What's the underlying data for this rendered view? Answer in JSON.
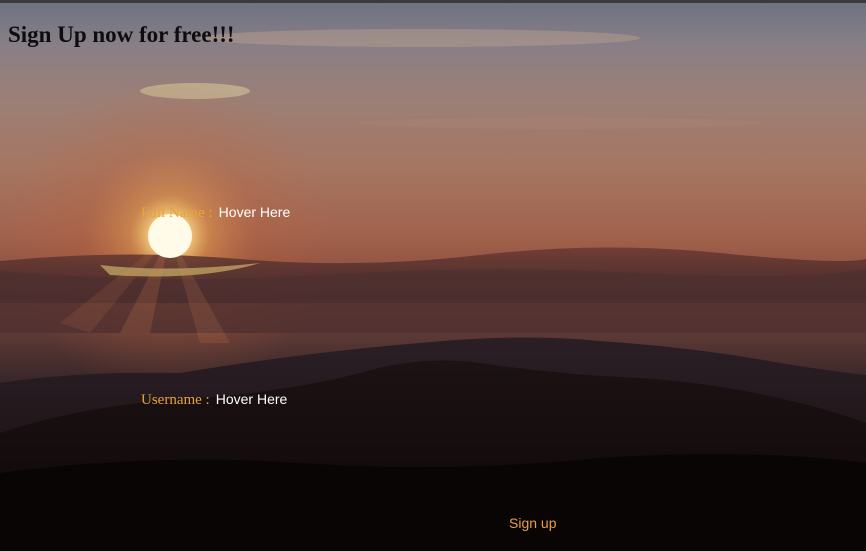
{
  "page": {
    "title": "Sign Up now for free!!!"
  },
  "form": {
    "full_name": {
      "label": "Full Name :",
      "placeholder": "Hover Here"
    },
    "username": {
      "label": "Username :",
      "placeholder": "Hover Here"
    },
    "submit_label": "Sign up"
  },
  "colors": {
    "label_color": "#e8a23a",
    "title_color": "#0d0d0d",
    "input_text_color": "#ffffff",
    "button_text_color": "#e8a23a"
  },
  "icons": {
    "background": "sunset-mountains-image"
  }
}
